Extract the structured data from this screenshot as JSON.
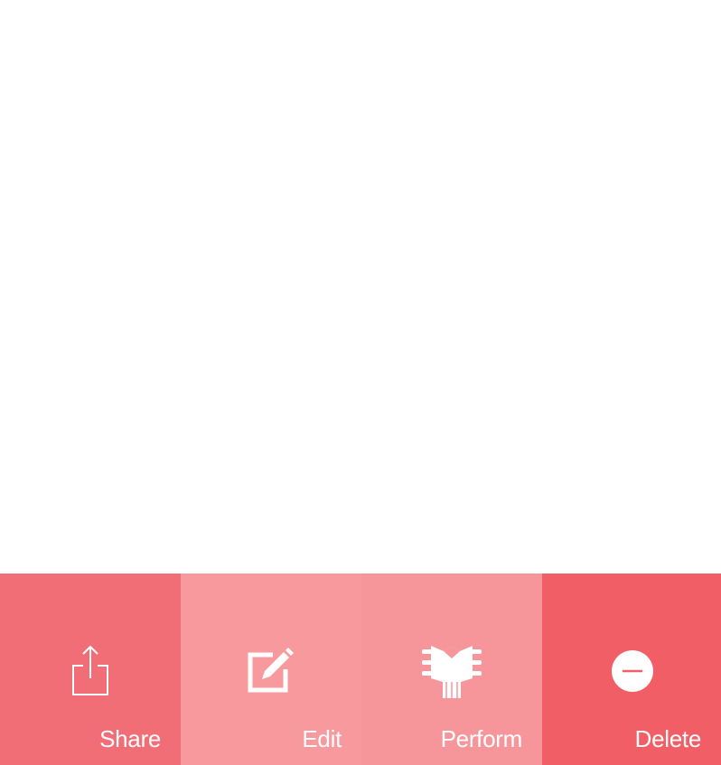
{
  "actions": [
    {
      "id": "share",
      "label": "Share",
      "icon": "share-icon",
      "color": "#F26E76"
    },
    {
      "id": "edit",
      "label": "Edit",
      "icon": "edit-icon",
      "color": "#F7999D"
    },
    {
      "id": "perform",
      "label": "Perform",
      "icon": "guitar-headstock-icon",
      "color": "#F6969B"
    },
    {
      "id": "delete",
      "label": "Delete",
      "icon": "minus-circle-icon",
      "color": "#F25E66"
    }
  ],
  "colors": {
    "background": "#FFFFFF",
    "label_text": "#FFFFFF"
  }
}
